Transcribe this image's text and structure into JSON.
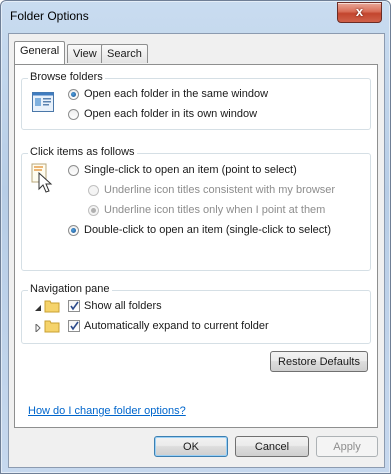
{
  "window": {
    "title": "Folder Options",
    "close_glyph": "x"
  },
  "tabs": [
    {
      "label": "General",
      "active": true
    },
    {
      "label": "View",
      "active": false
    },
    {
      "label": "Search",
      "active": false
    }
  ],
  "browse_folders": {
    "heading": "Browse folders",
    "icon": "window-pane-icon",
    "options": [
      {
        "label": "Open each folder in the same window",
        "checked": true
      },
      {
        "label": "Open each folder in its own window",
        "checked": false
      }
    ]
  },
  "click_items": {
    "heading": "Click items as follows",
    "icon": "pointer-click-icon",
    "single_click": "Single-click to open an item (point to select)",
    "underline_browser": "Underline icon titles consistent with my browser",
    "underline_point": "Underline icon titles only when I point at them",
    "double_click": "Double-click to open an item (single-click to select)"
  },
  "navigation_pane": {
    "heading": "Navigation pane",
    "show_all_folders": "Show all folders",
    "auto_expand": "Automatically expand to current folder"
  },
  "buttons": {
    "restore_defaults": "Restore Defaults",
    "ok": "OK",
    "cancel": "Cancel",
    "apply": "Apply"
  },
  "help_link": "How do I change folder options?",
  "colors": {
    "link": "#0066cc",
    "title_bar": "#c9dcf0",
    "close_button": "#c2452e"
  }
}
